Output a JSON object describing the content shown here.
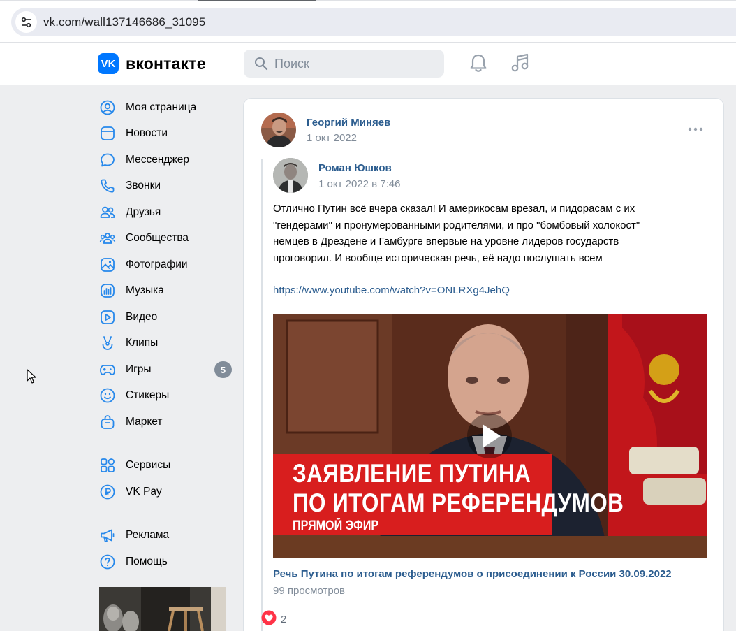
{
  "browser": {
    "url": "vk.com/wall137146686_31095",
    "site_info_icon": "tune-icon"
  },
  "header": {
    "logo_text": "вконтакте",
    "logo_mark": "VK",
    "search_placeholder": "Поиск",
    "icons": [
      "bell-icon",
      "music-icon"
    ],
    "brand_color": "#0077ff"
  },
  "sidebar": {
    "items": [
      {
        "label": "Моя страница",
        "icon": "profile-icon"
      },
      {
        "label": "Новости",
        "icon": "news-icon"
      },
      {
        "label": "Мессенджер",
        "icon": "messenger-icon"
      },
      {
        "label": "Звонки",
        "icon": "phone-icon"
      },
      {
        "label": "Друзья",
        "icon": "friends-icon"
      },
      {
        "label": "Сообщества",
        "icon": "communities-icon"
      },
      {
        "label": "Фотографии",
        "icon": "photos-icon"
      },
      {
        "label": "Музыка",
        "icon": "music-icon"
      },
      {
        "label": "Видео",
        "icon": "video-icon"
      },
      {
        "label": "Клипы",
        "icon": "clips-icon"
      },
      {
        "label": "Игры",
        "icon": "games-icon",
        "badge": "5"
      },
      {
        "label": "Стикеры",
        "icon": "stickers-icon"
      },
      {
        "label": "Маркет",
        "icon": "market-icon"
      }
    ],
    "items2": [
      {
        "label": "Сервисы",
        "icon": "services-icon"
      },
      {
        "label": "VK Pay",
        "icon": "vkpay-icon"
      }
    ],
    "items3": [
      {
        "label": "Реклама",
        "icon": "megaphone-icon"
      },
      {
        "label": "Помощь",
        "icon": "help-icon"
      }
    ]
  },
  "post": {
    "author": "Георгий Миняев",
    "date": "1 окт 2022",
    "repost": {
      "author": "Роман Юшков",
      "date": "1 окт 2022 в 7:46",
      "text_lines": [
        "Отлично Путин всё вчера сказал! И америкосам врезал, и пидорасам с их",
        "\"гендерами\" и пронумерованными родителями, и про \"бомбовый холокост\"",
        "немцев в Дрездене и Гамбурге впервые на уровне лидеров государств",
        "проговорил. И вообще историческая речь, её надо послушать всем"
      ],
      "link": "https://www.youtube.com/watch?v=ONLRXg4JehQ",
      "video": {
        "caption_line1": "ЗАЯВЛЕНИЕ ПУТИНА",
        "caption_line2": "ПО ИТОГАМ РЕФЕРЕНДУМОВ",
        "caption_line3": "ПРЯМОЙ ЭФИР",
        "title": "Речь Путина по итогам референдумов о присоединении к России 30.09.2022",
        "views": "99 просмотров"
      }
    },
    "likes": "2"
  }
}
